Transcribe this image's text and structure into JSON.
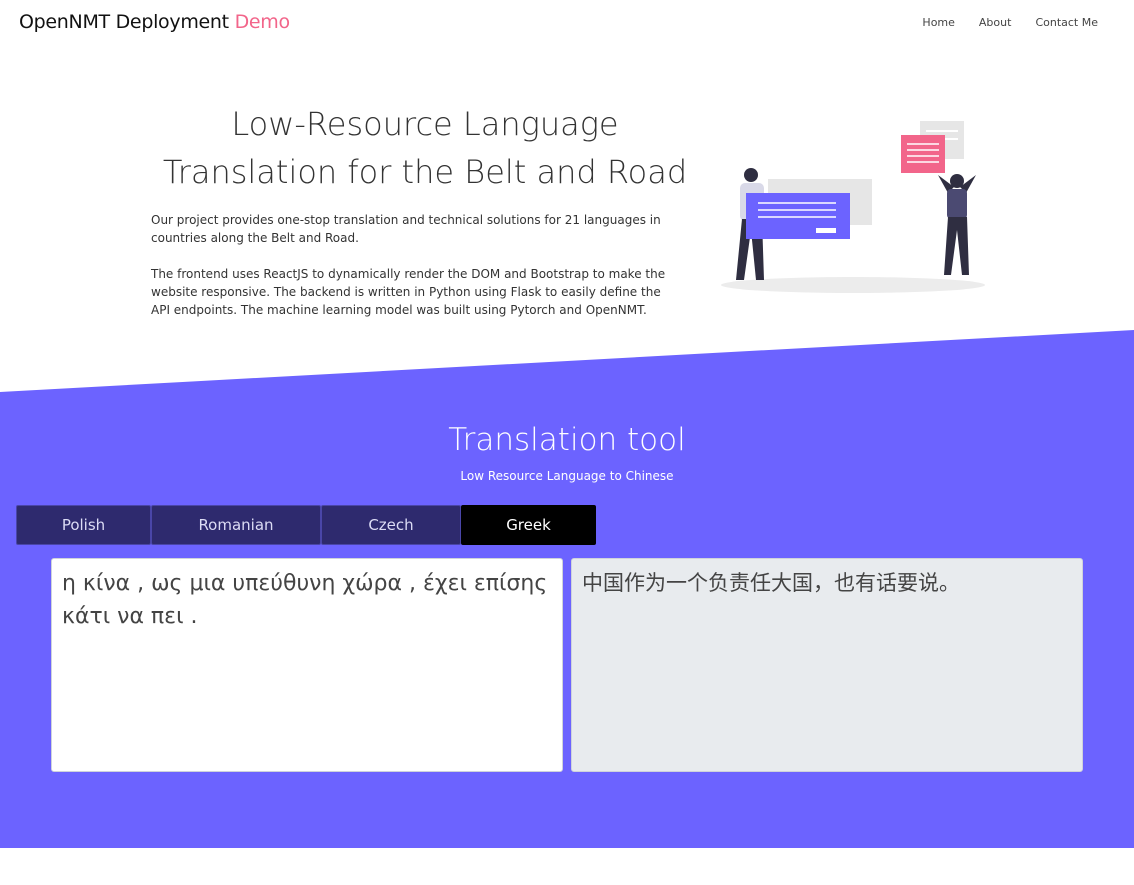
{
  "colors": {
    "accent_pink": "#f2658a",
    "purple": "#6c63ff",
    "tab_dark": "#2e2a6e",
    "tab_active": "#000000"
  },
  "nav": {
    "brand": "OpenNMT Deployment",
    "brand_accent": "Demo",
    "links": [
      "Home",
      "About",
      "Contact Me"
    ]
  },
  "hero": {
    "title_line1": "Low-Resource Language",
    "title_line2": "Translation for the Belt and Road",
    "paragraph1": "Our project provides one-stop translation and technical solutions for 21 languages in countries along the Belt and Road.",
    "paragraph2": "The frontend uses ReactJS to dynamically render the DOM and Bootstrap to make the website responsive. The backend is written in Python using Flask to easily define the API endpoints. The machine learning model was built using Pytorch and OpenNMT."
  },
  "tool": {
    "title": "Translation tool",
    "subtitle": "Low Resource Language to Chinese",
    "tabs": [
      {
        "label": "Polish",
        "active": false
      },
      {
        "label": "Romanian",
        "active": false
      },
      {
        "label": "Czech",
        "active": false
      },
      {
        "label": "Greek",
        "active": true
      }
    ],
    "source_text": "η κίνα , ως μια υπεύθυνη χώρα , έχει επίσης κάτι να πει .",
    "target_text": "中国作为一个负责任大国，也有话要说。"
  }
}
